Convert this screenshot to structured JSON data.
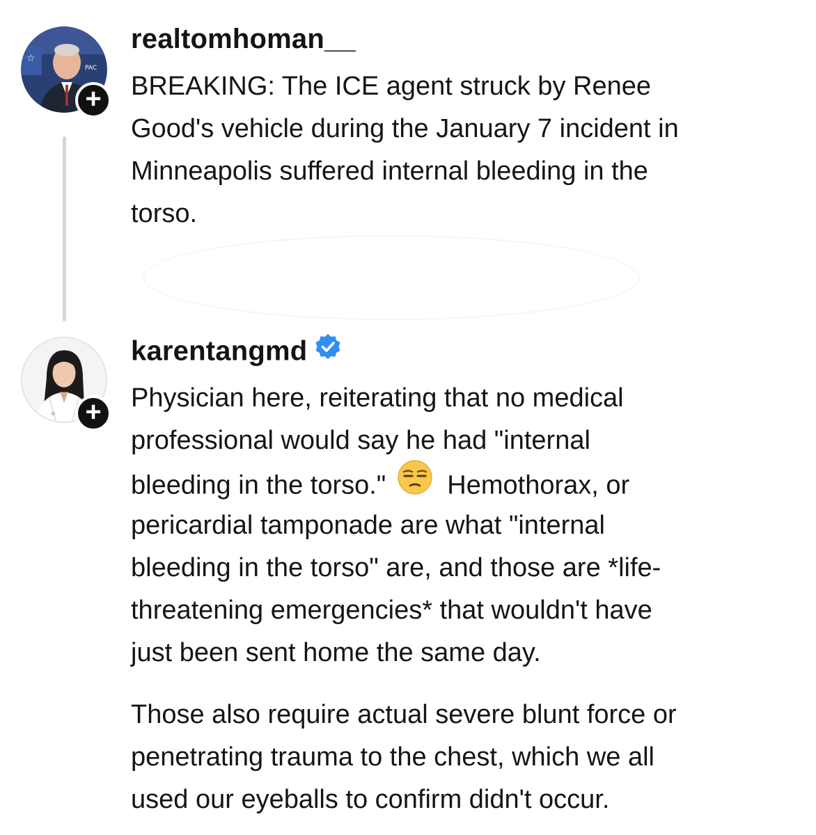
{
  "post1": {
    "username": "realtomhoman__",
    "follow_glyph": "+",
    "lines": [
      "BREAKING: The ICE agent struck by Renee",
      "Good's vehicle during the January 7 incident in",
      "Minneapolis suffered internal bleeding in the",
      "torso."
    ]
  },
  "post2": {
    "username": "karentangmd",
    "verified_icon": "verified-badge-icon",
    "follow_glyph": "+",
    "paragraph1": {
      "line1": "Physician here, reiterating that no medical",
      "line2": "professional would say he had \"internal",
      "line3_before_emoji": "bleeding in the torso.\"",
      "line3_emoji": "unamused-face-icon",
      "line3_after_emoji": "Hemothorax, or",
      "line4": "pericardial tamponade are what \"internal",
      "line5": "bleeding in the torso\" are, and those are *life-",
      "line6": "threatening emergencies* that wouldn't have",
      "line7": "just been sent home the same day."
    },
    "paragraph2": [
      "Those also require actual severe blunt force or",
      "penetrating trauma to the chest, which we all",
      "used our eyeballs to confirm didn't occur."
    ]
  },
  "colors": {
    "text": "#151515",
    "thread_line": "#d6d6d6",
    "verified_blue": "#2f8ff0",
    "badge": "#111111"
  }
}
